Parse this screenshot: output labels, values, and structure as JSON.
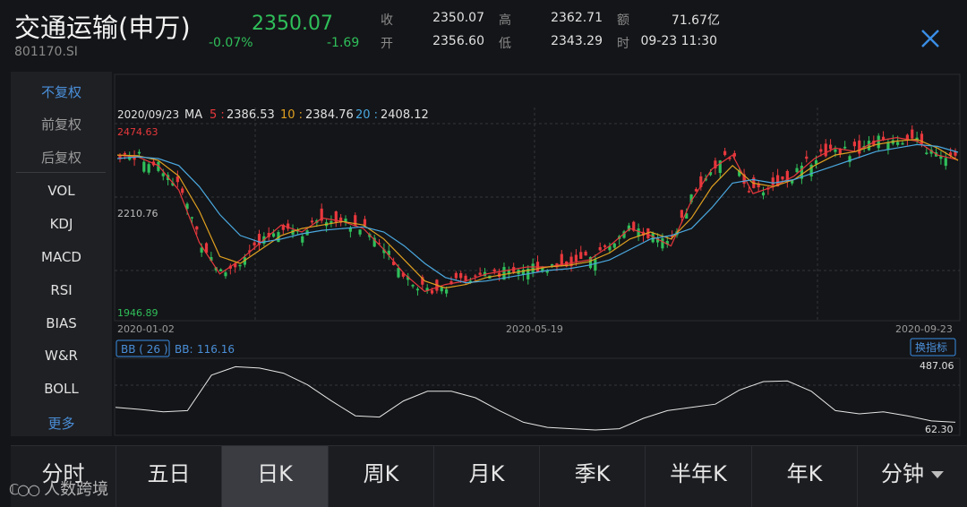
{
  "header": {
    "name": "交通运输(申万)",
    "code": "801170.SI",
    "price": "2350.07",
    "change_pct": "-0.07%",
    "change": "-1.69",
    "close_label": "收",
    "close_value": "2350.07",
    "open_label": "开",
    "open_value": "2356.60",
    "high_label": "高",
    "high_value": "2362.71",
    "low_label": "低",
    "low_value": "2343.29",
    "amount_label": "额",
    "amount_value": "71.67亿",
    "time_label": "时",
    "time_value": "09-23 11:30"
  },
  "sidebar": {
    "adjust": [
      "不复权",
      "前复权",
      "后复权"
    ],
    "indicators": [
      "VOL",
      "KDJ",
      "MACD",
      "RSI",
      "BIAS",
      "W&R",
      "BOLL"
    ],
    "more": "更多"
  },
  "chart": {
    "date": "2020/09/23",
    "ma_label": "MA",
    "ma5_label": "5 :",
    "ma5_value": "2386.53",
    "ma10_label": "10 :",
    "ma10_value": "2384.76",
    "ma20_label": "20 :",
    "ma20_value": "2408.12",
    "y_max": "2474.63",
    "y_mid": "2210.76",
    "y_min": "1946.89",
    "x_start": "2020-01-02",
    "x_mid": "2020-05-19",
    "x_end": "2020-09-23",
    "colors": {
      "up": "#e8383d",
      "down": "#2fbf5a",
      "ma5": "#e8383d",
      "ma10": "#e0a020",
      "ma20": "#4aa8e0"
    }
  },
  "indicator_panel": {
    "label": "BB ( 26 )",
    "name_label": "BB:",
    "value": "116.16",
    "switch_button": "换指标",
    "max": "487.06",
    "min": "62.30"
  },
  "tabs": [
    "分时",
    "五日",
    "日K",
    "周K",
    "月K",
    "季K",
    "半年K",
    "年K",
    "分钟"
  ],
  "active_tab": "日K",
  "watermark": "人数跨境",
  "chart_data": {
    "type": "line",
    "title": "",
    "x_range": [
      "2020-01-02",
      "2020-09-23"
    ],
    "ylim": [
      1946.89,
      2474.63
    ],
    "series": [
      {
        "name": "5",
        "values": [
          2400,
          2395,
          2370,
          2300,
          2150,
          2060,
          2100,
          2150,
          2200,
          2180,
          2220,
          2210,
          2190,
          2130,
          2060,
          2010,
          2030,
          2040,
          2060,
          2070,
          2080,
          2080,
          2090,
          2100,
          2140,
          2190,
          2170,
          2140,
          2270,
          2360,
          2400,
          2290,
          2310,
          2340,
          2390,
          2420,
          2410,
          2440,
          2450,
          2440,
          2400,
          2386.53
        ]
      },
      {
        "name": "10",
        "values": [
          2400,
          2398,
          2385,
          2340,
          2240,
          2110,
          2090,
          2130,
          2170,
          2190,
          2200,
          2210,
          2200,
          2160,
          2100,
          2040,
          2020,
          2030,
          2050,
          2060,
          2070,
          2080,
          2085,
          2095,
          2120,
          2160,
          2180,
          2160,
          2220,
          2310,
          2370,
          2320,
          2310,
          2330,
          2370,
          2400,
          2410,
          2430,
          2440,
          2445,
          2420,
          2384.76
        ]
      },
      {
        "name": "20",
        "values": [
          2390,
          2395,
          2390,
          2370,
          2310,
          2230,
          2170,
          2150,
          2160,
          2175,
          2185,
          2190,
          2195,
          2180,
          2140,
          2090,
          2050,
          2035,
          2040,
          2050,
          2060,
          2070,
          2075,
          2085,
          2100,
          2130,
          2160,
          2170,
          2190,
          2250,
          2320,
          2330,
          2320,
          2330,
          2350,
          2370,
          2390,
          2410,
          2420,
          2430,
          2425,
          2408.12
        ]
      }
    ],
    "indicator": {
      "name": "BB",
      "period": 26,
      "last": 116.16,
      "ylim": [
        62.3,
        487.06
      ]
    }
  }
}
